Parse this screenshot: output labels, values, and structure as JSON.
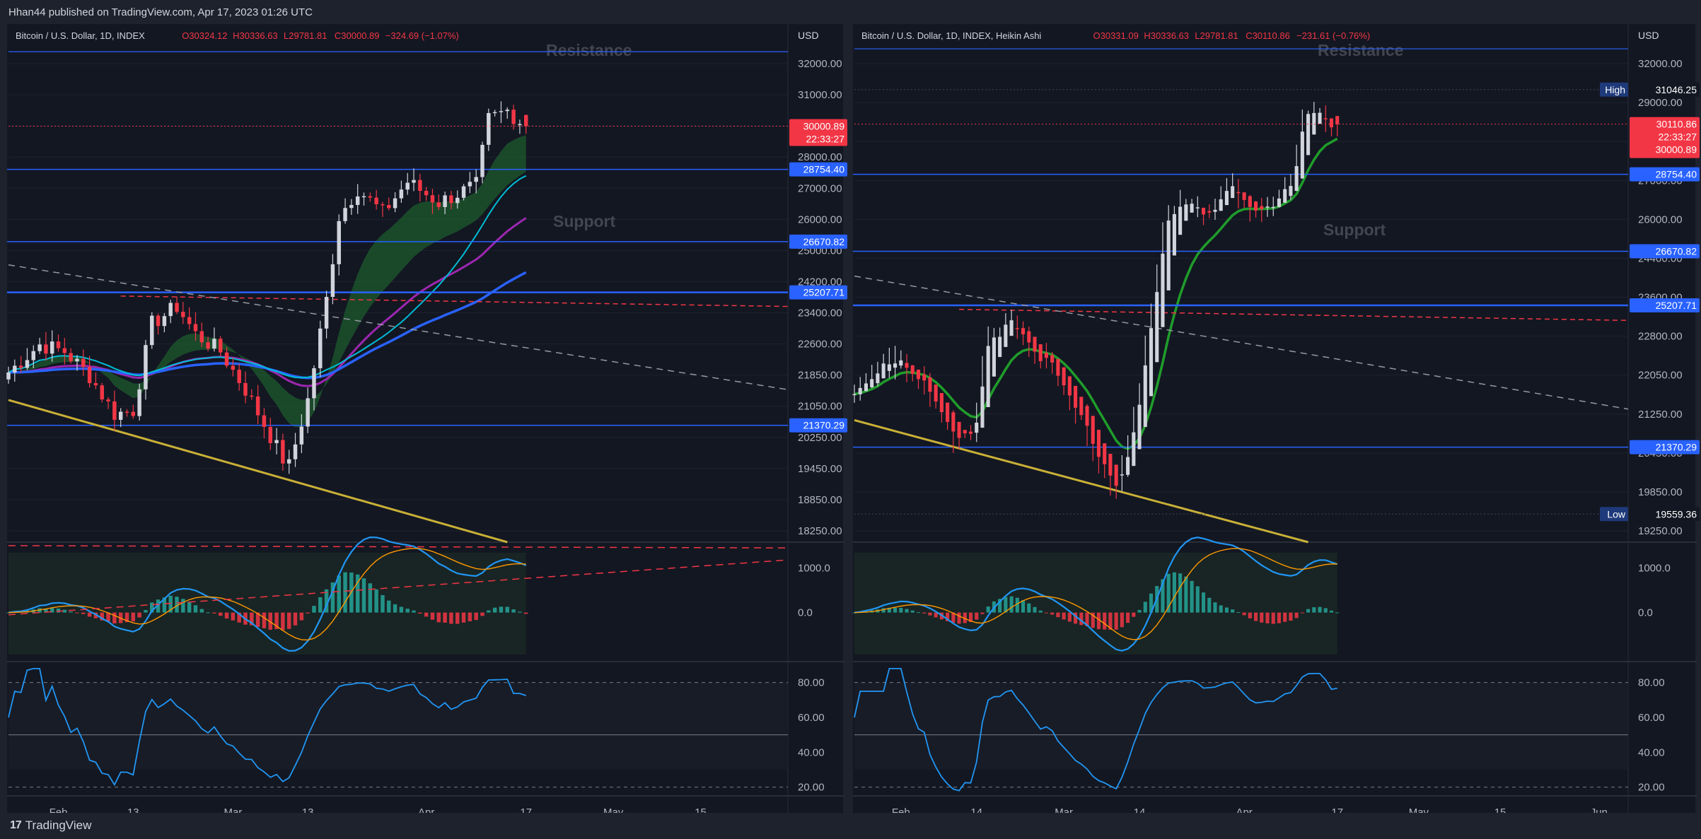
{
  "header": {
    "publish_text": "Hhan44 published on TradingView.com, Apr 17, 2023 01:26 UTC"
  },
  "footer": {
    "brand": "TradingView",
    "logo_glyph": "17"
  },
  "colors": {
    "up": "#d1d4dc",
    "down": "#f23645",
    "blue_line": "#2962ff",
    "level_label": "#2962ff",
    "price_label": "#f23645",
    "cloud": "#1e5b2e",
    "ma_purple": "#9c27b0",
    "ma_cyan": "#00bcd4",
    "ma_blue": "#2962ff",
    "trend_yellow": "#c9b037",
    "macd": "#2196f3",
    "signal": "#ff9800",
    "rsi": "#2196f3"
  },
  "panes": [
    {
      "id": "left",
      "legend": {
        "symbol": "Bitcoin / U.S. Dollar, 1D, INDEX",
        "o": "O30324.12",
        "h": "H30336.63",
        "l": "L29781.81",
        "c": "C30000.89",
        "chg": "−324.69 (−1.07%)"
      },
      "currency": "USD",
      "annotations": [
        "Resistance",
        "Support"
      ],
      "price_ticks": [
        "32000.00",
        "31000.00",
        "30000.00",
        "28000.00",
        "27000.00",
        "26000.00",
        "25000.00",
        "24200.00",
        "23400.00",
        "22600.00",
        "21850.00",
        "21050.00",
        "20250.00",
        "19450.00",
        "18850.00",
        "18250.00"
      ],
      "level_labels": [
        "28754.40",
        "26670.82",
        "25207.71",
        "21370.29"
      ],
      "last_price": {
        "price": "30000.89",
        "countdown": "22:33:27"
      },
      "time_ticks": [
        "Feb",
        "13",
        "Mar",
        "13",
        "Apr",
        "17",
        "May",
        "15"
      ],
      "macd_ticks": [
        "1000.0",
        "0.0"
      ],
      "rsi_ticks": [
        "80.00",
        "60.00",
        "40.00",
        "20.00"
      ]
    },
    {
      "id": "right",
      "legend": {
        "symbol": "Bitcoin / U.S. Dollar, 1D, INDEX, Heikin Ashi",
        "o": "O30331.09",
        "h": "H30336.63",
        "l": "L29781.81",
        "c": "C30110.86",
        "chg": "−231.61 (−0.76%)"
      },
      "currency": "USD",
      "annotations": [
        "Resistance",
        "Support"
      ],
      "price_ticks": [
        "32000.00",
        "29000.00",
        "28000.00",
        "27000.00",
        "26000.00",
        "24400.00",
        "23600.00",
        "22800.00",
        "22050.00",
        "21250.00",
        "20450.00",
        "19850.00",
        "19250.00"
      ],
      "level_labels": [
        "28754.40",
        "26670.82",
        "25207.71",
        "21370.29"
      ],
      "high_label": {
        "tag": "High",
        "value": "31046.25"
      },
      "low_label": {
        "tag": "Low",
        "value": "19559.36"
      },
      "last_price": {
        "price": "30110.86",
        "countdown": "22:33:27",
        "prev": "30000.89"
      },
      "time_ticks": [
        "Feb",
        "14",
        "Mar",
        "14",
        "Apr",
        "17",
        "May",
        "15",
        "Jun"
      ],
      "macd_ticks": [
        "1000.0",
        "0.0"
      ],
      "rsi_ticks": [
        "80.00",
        "60.00",
        "40.00",
        "20.00"
      ]
    }
  ],
  "chart_data": [
    {
      "type": "candlestick",
      "title": "Bitcoin / U.S. Dollar, 1D, INDEX",
      "x_range": [
        "2023-01-24",
        "2023-05-29"
      ],
      "ylim": [
        18000,
        32500
      ],
      "horizontal_levels": [
        28754.4,
        26670.82,
        25207.71,
        21370.29
      ],
      "anchors": [
        {
          "date": "2023-01-24",
          "close": 22900
        },
        {
          "date": "2023-01-29",
          "close": 23700
        },
        {
          "date": "2023-02-02",
          "close": 23500
        },
        {
          "date": "2023-02-06",
          "close": 22800
        },
        {
          "date": "2023-02-10",
          "close": 21700
        },
        {
          "date": "2023-02-13",
          "close": 21800
        },
        {
          "date": "2023-02-16",
          "close": 24300
        },
        {
          "date": "2023-02-20",
          "close": 24800
        },
        {
          "date": "2023-02-23",
          "close": 24000
        },
        {
          "date": "2023-02-27",
          "close": 23500
        },
        {
          "date": "2023-03-03",
          "close": 22400
        },
        {
          "date": "2023-03-09",
          "close": 20400
        },
        {
          "date": "2023-03-10",
          "close": 20200
        },
        {
          "date": "2023-03-13",
          "close": 22100
        },
        {
          "date": "2023-03-16",
          "close": 25000
        },
        {
          "date": "2023-03-18",
          "close": 27400
        },
        {
          "date": "2023-03-21",
          "close": 28200
        },
        {
          "date": "2023-03-25",
          "close": 27500
        },
        {
          "date": "2023-03-29",
          "close": 28400
        },
        {
          "date": "2023-04-03",
          "close": 27800
        },
        {
          "date": "2023-04-09",
          "close": 28300
        },
        {
          "date": "2023-04-11",
          "close": 30200
        },
        {
          "date": "2023-04-14",
          "close": 30450
        },
        {
          "date": "2023-04-17",
          "close": 30000.89
        }
      ],
      "last": {
        "date": "2023-04-17",
        "open": 30324.12,
        "high": 30336.63,
        "low": 29781.81,
        "close": 30000.89
      }
    },
    {
      "type": "candlestick",
      "title": "Bitcoin / U.S. Dollar, 1D, INDEX, Heikin Ashi",
      "x_range": [
        "2023-01-24",
        "2023-06-06"
      ],
      "ylim": [
        18800,
        32400
      ],
      "high": 31046.25,
      "low": 19559.36,
      "horizontal_levels": [
        28754.4,
        26670.82,
        25207.71,
        21370.29
      ],
      "last": {
        "date": "2023-04-17",
        "open": 30331.09,
        "high": 30336.63,
        "low": 29781.81,
        "close": 30110.86
      }
    }
  ]
}
